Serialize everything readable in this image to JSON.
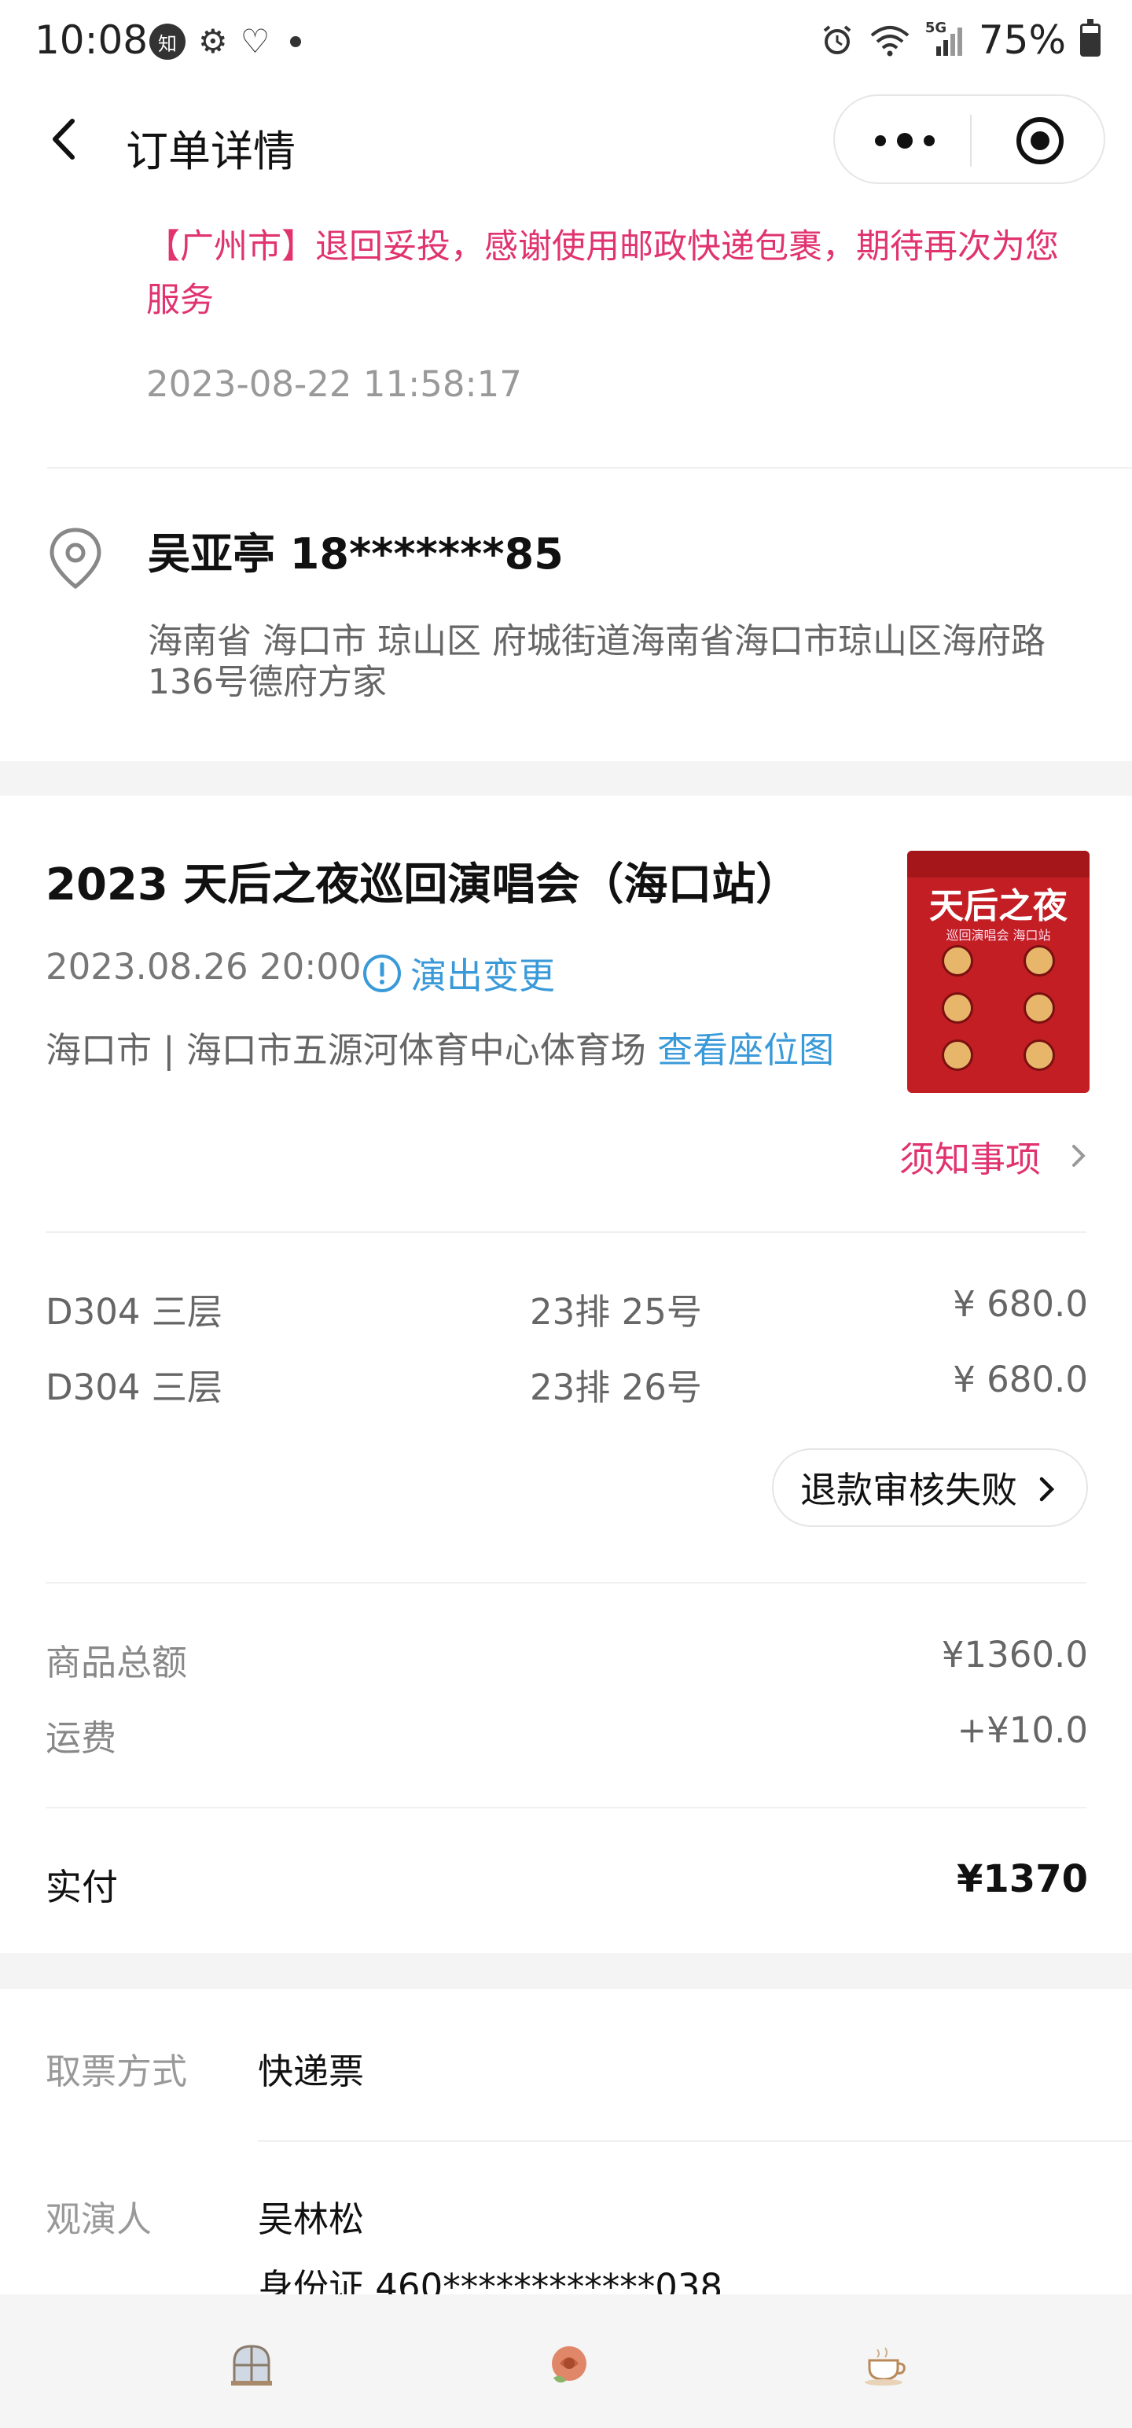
{
  "status_bar": {
    "time": "10:08",
    "app_badge": "知",
    "battery": "75%",
    "battery_level": 0.75,
    "network": "5G"
  },
  "nav": {
    "title": "订单详情"
  },
  "logistics": {
    "message": "【广州市】退回妥投，感谢使用邮政快递包裹，期待再次为您服务",
    "time": "2023-08-22 11:58:17",
    "color": "#e0336f"
  },
  "address": {
    "name_phone": "吴亚亭 18*******85",
    "detail": "海南省 海口市 琼山区 府城街道海南省海口市琼山区海府路136号德府方家"
  },
  "show": {
    "title": "2023 天后之夜巡回演唱会（海口站）",
    "datetime": "2023.08.26 20:00",
    "change_label": "演出变更",
    "venue": "海口市 | 海口市五源河体育中心体育场",
    "seat_map_label": "查看座位图",
    "notice_label": "须知事项",
    "poster": {
      "title": "天后之夜",
      "subtitle": "巡回演唱会 海口站"
    },
    "link_color": "#3a9ad9"
  },
  "tickets": [
    {
      "zone": "D304 三层",
      "seat": "23排 25号",
      "price": "¥ 680.0"
    },
    {
      "zone": "D304 三层",
      "seat": "23排 26号",
      "price": "¥ 680.0"
    }
  ],
  "refund": {
    "label": "退款审核失败"
  },
  "totals": {
    "subtotal_label": "商品总额",
    "subtotal_value": "¥1360.0",
    "shipping_label": "运费",
    "shipping_value": "+¥10.0",
    "paid_label": "实付",
    "paid_value": "¥1370"
  },
  "info": {
    "delivery_label": "取票方式",
    "delivery_value": "快递票",
    "attendee_label": "观演人",
    "attendee_name": "吴林松",
    "attendee_id": "身份证 460************038"
  },
  "tabbar": {
    "icons": [
      "window-icon",
      "rose-icon",
      "teacup-icon"
    ]
  }
}
